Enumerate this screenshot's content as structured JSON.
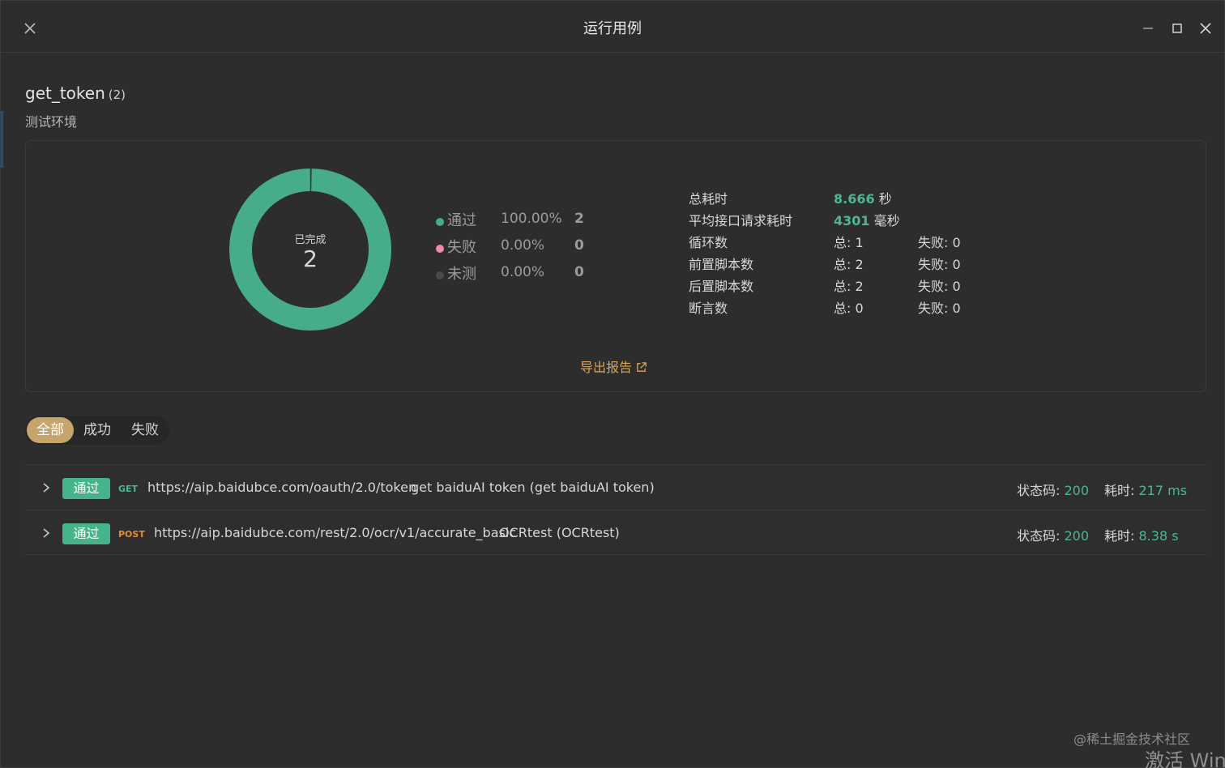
{
  "window": {
    "title": "运行用例"
  },
  "header": {
    "case_name": "get_token",
    "case_count": "(2)",
    "environment": "测试环境"
  },
  "summary": {
    "donut": {
      "label": "已完成",
      "value": "2",
      "pass_fraction": 1.0,
      "pass_color": "#46ad88"
    },
    "legend": [
      {
        "name": "通过",
        "percent": "100.00%",
        "count": "2",
        "color": "#46ad88"
      },
      {
        "name": "失败",
        "percent": "0.00%",
        "count": "0",
        "color": "#f08aa8"
      },
      {
        "name": "未测",
        "percent": "0.00%",
        "count": "0",
        "color": "#4a4a4a"
      }
    ],
    "stats": {
      "total_time": {
        "label": "总耗时",
        "value": "8.666",
        "unit": "秒"
      },
      "avg_request_time": {
        "label": "平均接口请求耗时",
        "value": "4301",
        "unit": "毫秒"
      },
      "loops": {
        "label": "循环数",
        "total": "总: 1",
        "failed": "失败: 0"
      },
      "pre_scripts": {
        "label": "前置脚本数",
        "total": "总: 2",
        "failed": "失败: 0"
      },
      "post_scripts": {
        "label": "后置脚本数",
        "total": "总: 2",
        "failed": "失败: 0"
      },
      "assertions": {
        "label": "断言数",
        "total": "总: 0",
        "failed": "失败: 0"
      }
    },
    "export_label": "导出报告"
  },
  "filters": {
    "all": "全部",
    "success": "成功",
    "fail": "失败"
  },
  "results": [
    {
      "status": "通过",
      "method": "GET",
      "url": "https://aip.baidubce.com/oauth/2.0/token",
      "name": "get baiduAI token (get baiduAI token)",
      "status_code_label": "状态码:",
      "status_code": "200",
      "time_label": "耗时:",
      "time": "217 ms"
    },
    {
      "status": "通过",
      "method": "POST",
      "url": "https://aip.baidubce.com/rest/2.0/ocr/v1/accurate_basic",
      "name": "OCRtest (OCRtest)",
      "status_code_label": "状态码:",
      "status_code": "200",
      "time_label": "耗时:",
      "time": "8.38 s"
    }
  ],
  "overlay": {
    "watermark": "@稀土掘金技术社区",
    "activate": "激活 Win"
  }
}
